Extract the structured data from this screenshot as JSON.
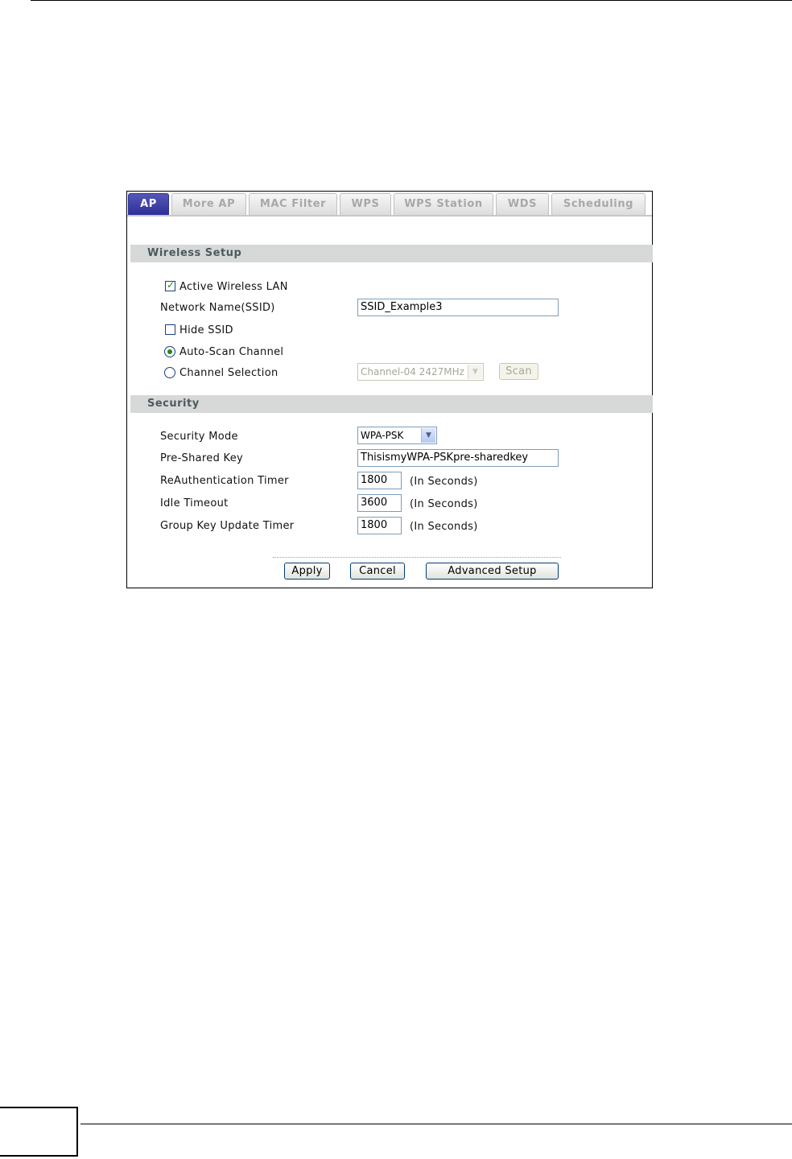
{
  "tabs": [
    {
      "label": "AP",
      "active": true
    },
    {
      "label": "More AP",
      "active": false
    },
    {
      "label": "MAC Filter",
      "active": false
    },
    {
      "label": "WPS",
      "active": false
    },
    {
      "label": "WPS Station",
      "active": false
    },
    {
      "label": "WDS",
      "active": false
    },
    {
      "label": "Scheduling",
      "active": false
    }
  ],
  "wireless_setup": {
    "title": "Wireless Setup",
    "active_wlan_label": "Active Wireless LAN",
    "active_wlan_checked": true,
    "ssid_label": "Network Name(SSID)",
    "ssid_value": "SSID_Example3",
    "hide_ssid_label": "Hide SSID",
    "hide_ssid_checked": false,
    "auto_scan_label": "Auto-Scan Channel",
    "auto_scan_selected": true,
    "channel_selection_label": "Channel Selection",
    "channel_value": "Channel-04 2427MHz",
    "scan_label": "Scan"
  },
  "security": {
    "title": "Security",
    "mode_label": "Security Mode",
    "mode_value": "WPA-PSK",
    "psk_label": "Pre-Shared Key",
    "psk_value": "ThisismyWPA-PSKpre-sharedkey",
    "reauth_label": "ReAuthentication Timer",
    "reauth_value": "1800",
    "idle_label": "Idle Timeout",
    "idle_value": "3600",
    "group_key_label": "Group Key Update Timer",
    "group_key_value": "1800",
    "unit_label": "(In Seconds)"
  },
  "buttons": {
    "apply": "Apply",
    "cancel": "Cancel",
    "advanced": "Advanced Setup"
  },
  "colors": {
    "active_tab": "#2c2f96",
    "section_bar": "#d6d9d8",
    "check_mark": "#1f8a1f"
  }
}
